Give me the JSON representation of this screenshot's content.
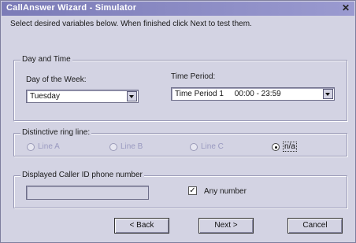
{
  "window": {
    "title": "CallAnswer Wizard - Simulator",
    "close_glyph": "✕"
  },
  "intro_text": "Select desired variables below. When finished click Next to test them.",
  "day_time": {
    "legend": "Day and Time",
    "day_label": "Day of the Week:",
    "day_value": "Tuesday",
    "period_label": "Time Period:",
    "period_value": "Time Period 1     00:00 - 23:59"
  },
  "ring_line": {
    "legend": "Distinctive ring line:",
    "options": [
      "Line A",
      "Line B",
      "Line C",
      "n/a"
    ],
    "selected": "n/a"
  },
  "caller_id": {
    "legend": "Displayed Caller ID phone number",
    "value": "",
    "any_number_label": "Any number",
    "any_number_checked": true,
    "check_glyph": "✓"
  },
  "buttons": {
    "back": "< Back",
    "next": "Next >",
    "cancel": "Cancel"
  }
}
